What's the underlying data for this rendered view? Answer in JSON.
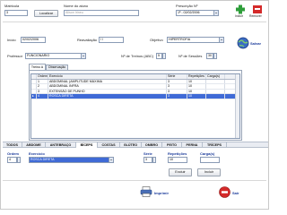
{
  "header": {
    "matricula_label": "Matricula",
    "matricula_value": "3",
    "localizar_button": "Localizar",
    "aluno_label": "Nome do aluno",
    "aluno_value": "Alison Irineu",
    "prescricao_label": "Prescrição Nº",
    "prescricao_value": "1ª - 02/02/2006",
    "incluir_label": "Incluir",
    "remover_label": "Remover"
  },
  "form": {
    "inicio_label": "Início",
    "inicio_value": "02/02/2006",
    "reavaliacao_label": "Reavaliação",
    "reavaliacao_value": "/ /",
    "objetivo_label": "Objetivo",
    "objetivo_value": "HIPERTROFIA",
    "salvar_label": "Salvar",
    "professor_label": "Professor",
    "professor_value": "FUNCIONARIO",
    "treinos_label": "Nº de Treinos (ABC)",
    "treinos_value": "5",
    "sessoes_label": "Nº de Sessões",
    "sessoes_value": "30"
  },
  "tabs": [
    "Treino A",
    "Observação"
  ],
  "grid": {
    "columns": [
      "Ordem",
      "Exercício",
      "Série",
      "Repetições",
      "Carga(s)"
    ],
    "rows": [
      {
        "ordem": "1",
        "exercicio": "ABDOMINAL (AMPLITUDE MÁXIMA",
        "serie": "3",
        "repeticoes": "10",
        "carga": ""
      },
      {
        "ordem": "2",
        "exercicio": "ABDOMINAL INFRA",
        "serie": "3",
        "repeticoes": "10",
        "carga": ""
      },
      {
        "ordem": "3",
        "exercicio": "EXTENSÃO DE PUNHO",
        "serie": "3",
        "repeticoes": "10",
        "carga": ""
      },
      {
        "ordem": "4",
        "exercicio": "ROSCA DIRETA",
        "serie": "3",
        "repeticoes": "10",
        "carga": ""
      }
    ],
    "selected_index": 3
  },
  "muscle_tabs": [
    "TODOS",
    "ABDOME",
    "ANTEBRAÇO",
    "BÍCEPS",
    "COSTAS",
    "GLÚTEO",
    "OMBRO",
    "PEITO",
    "PERNA",
    "TRÍCEPS"
  ],
  "active_muscle_tab": 3,
  "editor": {
    "ordem_label": "Ordem",
    "ordem_value": "4",
    "exercicio_label": "Exercício",
    "exercicio_value": "ROSCA DIRETA",
    "serie_label": "Série",
    "serie_value": "3",
    "repeticoes_label": "Repetições",
    "repeticoes_value": "10",
    "carga_label": "Carga(s)",
    "carga_value": "",
    "excluir_button": "Excluir",
    "incluir_button": "Incluir"
  },
  "footer": {
    "imprimir_label": "Imprimir",
    "sair_label": "Sair"
  },
  "colors": {
    "label_blue": "#1a3a9a",
    "selection": "#3f6ad6",
    "add_green": "#2e9e3a",
    "remove_red": "#d42a2a"
  }
}
